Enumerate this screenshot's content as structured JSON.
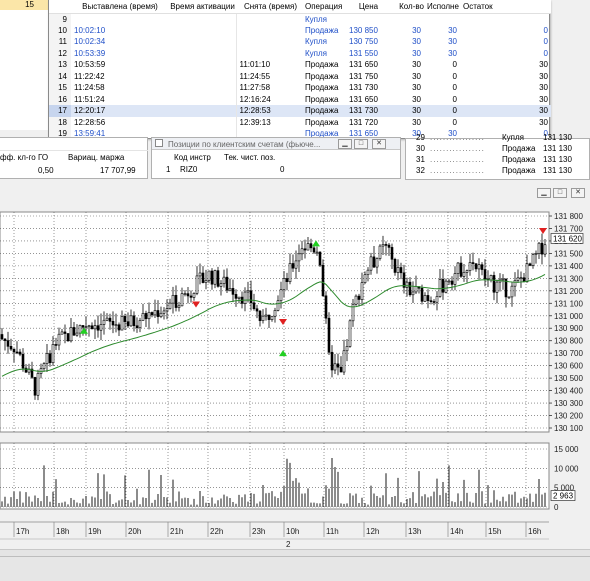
{
  "top_left": {
    "value": "15"
  },
  "orders": {
    "headers": [
      "Выставлена (время)",
      "Время активации",
      "Снята (время)",
      "Операция",
      "Цена",
      "Кол-во",
      "Исполне",
      "Остаток"
    ],
    "rows": [
      {
        "n": "9",
        "placed": "",
        "activated": "",
        "removed": "",
        "op": "Купля",
        "price": "",
        "qty": "",
        "filled": "",
        "rest": "",
        "blue": true,
        "sel": false
      },
      {
        "n": "10",
        "placed": "10:02:10",
        "activated": "",
        "removed": "",
        "op": "Продажа",
        "price": "130 850",
        "qty": "30",
        "filled": "30",
        "rest": "0",
        "blue": true,
        "sel": false
      },
      {
        "n": "11",
        "placed": "10:02:34",
        "activated": "",
        "removed": "",
        "op": "Купля",
        "price": "130 750",
        "qty": "30",
        "filled": "30",
        "rest": "0",
        "blue": true,
        "sel": false
      },
      {
        "n": "12",
        "placed": "10:53:39",
        "activated": "",
        "removed": "",
        "op": "Купля",
        "price": "131 550",
        "qty": "30",
        "filled": "30",
        "rest": "0",
        "blue": true,
        "sel": false
      },
      {
        "n": "13",
        "placed": "10:53:59",
        "activated": "",
        "removed": "11:01:10",
        "op": "Продажа",
        "price": "131 650",
        "qty": "30",
        "filled": "0",
        "rest": "30",
        "blue": false,
        "sel": false
      },
      {
        "n": "14",
        "placed": "11:22:42",
        "activated": "",
        "removed": "11:24:55",
        "op": "Продажа",
        "price": "131 750",
        "qty": "30",
        "filled": "0",
        "rest": "30",
        "blue": false,
        "sel": false
      },
      {
        "n": "15",
        "placed": "11:24:58",
        "activated": "",
        "removed": "11:27:58",
        "op": "Продажа",
        "price": "131 730",
        "qty": "30",
        "filled": "0",
        "rest": "30",
        "blue": false,
        "sel": false
      },
      {
        "n": "16",
        "placed": "11:51:24",
        "activated": "",
        "removed": "12:16:24",
        "op": "Продажа",
        "price": "131 650",
        "qty": "30",
        "filled": "0",
        "rest": "30",
        "blue": false,
        "sel": false
      },
      {
        "n": "17",
        "placed": "12:20:17",
        "activated": "",
        "removed": "12:28:53",
        "op": "Продажа",
        "price": "131 730",
        "qty": "30",
        "filled": "0",
        "rest": "30",
        "blue": false,
        "sel": true
      },
      {
        "n": "18",
        "placed": "12:28:56",
        "activated": "",
        "removed": "12:39:13",
        "op": "Продажа",
        "price": "131 720",
        "qty": "30",
        "filled": "0",
        "rest": "30",
        "blue": false,
        "sel": false
      },
      {
        "n": "19",
        "placed": "13:59:41",
        "activated": "",
        "removed": "",
        "op": "Продажа",
        "price": "131 650",
        "qty": "30",
        "filled": "30",
        "rest": "0",
        "blue": true,
        "sel": false
      }
    ]
  },
  "right_list": {
    "rows": [
      {
        "n": "29",
        "op": "Купля",
        "price": "131 130"
      },
      {
        "n": "30",
        "op": "Продажа",
        "price": "131 130"
      },
      {
        "n": "31",
        "op": "Продажа",
        "price": "131 130"
      },
      {
        "n": "32",
        "op": "Продажа",
        "price": "131 130"
      }
    ]
  },
  "margin": {
    "h1": "фф. кл-го ГО",
    "h2": "Вариац. маржа",
    "v1": "0,50",
    "v2": "17 707,99"
  },
  "positions": {
    "title": "Позиции по клиентским счетам (фьюче...",
    "h1": "Код инстр",
    "h2": "Тек. чист. поз.",
    "row_n": "1",
    "code": "RIZ0",
    "pos": "0"
  },
  "chart": {
    "price_ticks": [
      "131 800",
      "131 700",
      "131 600",
      "131 500",
      "131 400",
      "131 300",
      "131 200",
      "131 100",
      "131 000",
      "130 900",
      "130 800",
      "130 700",
      "130 600",
      "130 500",
      "130 400",
      "130 300",
      "130 200",
      "130 100"
    ],
    "last_price": "131 620",
    "volume_ticks": [
      "15 000",
      "10 000",
      "5 000",
      "0"
    ],
    "last_volume": "2 963",
    "time_labels": [
      "17h",
      "18h",
      "19h",
      "20h",
      "21h",
      "22h",
      "23h",
      "10h",
      "11h",
      "12h",
      "13h",
      "14h",
      "15h",
      "16h"
    ],
    "day_label": "2"
  }
}
